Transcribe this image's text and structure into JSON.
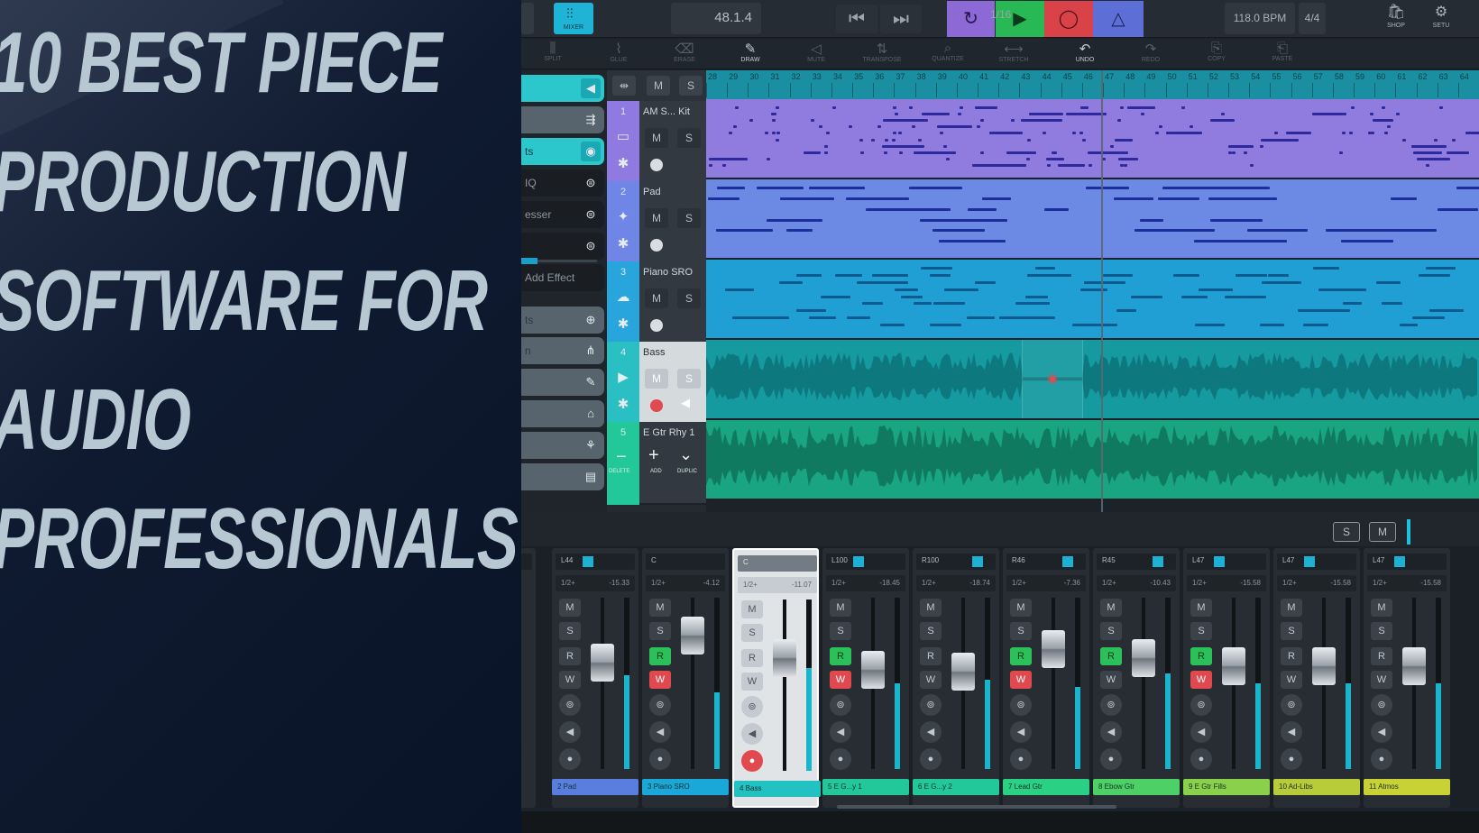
{
  "headline": {
    "lines": [
      "10 BEST PIECE",
      "PRODUCTION",
      "SOFTWARE FOR",
      "AUDIO",
      "PROFESSIONALS"
    ]
  },
  "daw": {
    "topbar": {
      "mixer_label": "MIXER",
      "position": "48.1.4",
      "tempo": "118.0 BPM",
      "signature": "4/4",
      "right": [
        {
          "label": "SHOP",
          "icon": "bag-icon"
        },
        {
          "label": "SETU",
          "icon": "gear-icon"
        }
      ]
    },
    "toolbar": {
      "tools": [
        {
          "label": "SPLIT",
          "icon": "split-icon"
        },
        {
          "label": "GLUE",
          "icon": "glue-icon"
        },
        {
          "label": "ERASE",
          "icon": "eraser-icon"
        },
        {
          "label": "DRAW",
          "icon": "pencil-icon",
          "active": true
        },
        {
          "label": "MUTE",
          "icon": "mute-icon"
        },
        {
          "label": "TRANSPOSE",
          "icon": "transpose-icon"
        },
        {
          "label": "QUANTIZE",
          "icon": "quantize-icon"
        },
        {
          "label": "STRETCH",
          "icon": "stretch-icon"
        },
        {
          "label": "UNDO",
          "icon": "undo-icon",
          "active": true
        },
        {
          "label": "REDO",
          "icon": "redo-icon"
        },
        {
          "label": "COPY",
          "icon": "copy-icon"
        },
        {
          "label": "PASTE",
          "icon": "paste-icon"
        }
      ],
      "quantize_value": "1/16"
    },
    "inspector": {
      "items": [
        "",
        "",
        "ts",
        "IQ",
        "esser",
        "",
        "Add Effect",
        "ts",
        "n",
        "",
        "",
        "",
        ""
      ]
    },
    "ruler": {
      "start": 28,
      "end": 64
    },
    "tracks": [
      {
        "num": "1",
        "name": "AM S... Kit",
        "color": "#8e7ae0",
        "lane": "#8f7cde",
        "notes": "#2e2a9e",
        "type": "midi"
      },
      {
        "num": "2",
        "name": "Pad",
        "color": "#6f86e6",
        "lane": "#6c8ae3",
        "notes": "#1c2f9c",
        "type": "midi"
      },
      {
        "num": "3",
        "name": "Piano SRO",
        "color": "#28a5dc",
        "lane": "#1f9fd4",
        "notes": "#0f5a8f",
        "type": "midi"
      },
      {
        "num": "4",
        "name": "Bass",
        "color": "#2abfc3",
        "lane": "#159aa0",
        "notes": "#0b6c72",
        "type": "audio"
      },
      {
        "num": "5",
        "name": "E Gtr Rhy 1",
        "color": "#22c79a",
        "lane": "#1aa582",
        "notes": "#0d6c55",
        "type": "audio"
      }
    ],
    "track_buttons": {
      "m": "M",
      "s": "S"
    },
    "track_footer": {
      "delete": "DELETE",
      "add": "ADD",
      "duplicate": "DUPLIC"
    },
    "mixer_header": {
      "s": "S",
      "m": "M"
    },
    "strips": [
      {
        "pan": "L44",
        "vol": "-15.33",
        "name": "2  Pad",
        "color": "#5a7ee0",
        "sel": false,
        "fader": 0.62,
        "meter": 0.55,
        "rw": false
      },
      {
        "pan": "C",
        "vol": "-4.12",
        "name": "3  Piano SRO",
        "color": "#1aa8d8",
        "sel": false,
        "fader": 0.78,
        "meter": 0.45,
        "rw": true
      },
      {
        "pan": "C",
        "vol": "-11.07",
        "name": "4  Bass",
        "color": "#22c2c3",
        "sel": true,
        "fader": 0.66,
        "meter": 0.6,
        "rw": false
      },
      {
        "pan": "L100",
        "vol": "-18.45",
        "name": "5  E G...y 1",
        "color": "#22c79a",
        "sel": false,
        "fader": 0.58,
        "meter": 0.5,
        "rw": true
      },
      {
        "pan": "R100",
        "vol": "-18.74",
        "name": "6  E G...y 2",
        "color": "#22c79a",
        "sel": false,
        "fader": 0.57,
        "meter": 0.52,
        "rw": false
      },
      {
        "pan": "R46",
        "vol": "-7.36",
        "name": "7  Lead Gtr",
        "color": "#2ad084",
        "sel": false,
        "fader": 0.7,
        "meter": 0.48,
        "rw": true
      },
      {
        "pan": "R45",
        "vol": "-10.43",
        "name": "8  Ebow Gtr",
        "color": "#4dd066",
        "sel": false,
        "fader": 0.65,
        "meter": 0.56,
        "rw": true
      },
      {
        "pan": "L47",
        "vol": "-15.58",
        "name": "9  E Gtr Fills",
        "color": "#8ad04a",
        "sel": false,
        "fader": 0.6,
        "meter": 0.5,
        "rw": true
      },
      {
        "pan": "L47",
        "vol": "-15.58",
        "name": "10  Ad-Libs",
        "color": "#b8cc3a",
        "sel": false,
        "fader": 0.6,
        "meter": 0.5,
        "rw": false
      },
      {
        "pan": "L47",
        "vol": "-15.58",
        "name": "11  Atmos",
        "color": "#c9d235",
        "sel": false,
        "fader": 0.6,
        "meter": 0.5,
        "rw": false
      }
    ],
    "strip_labels": {
      "m": "M",
      "s": "S",
      "r": "R",
      "w": "W",
      "io": "1/2+"
    }
  }
}
